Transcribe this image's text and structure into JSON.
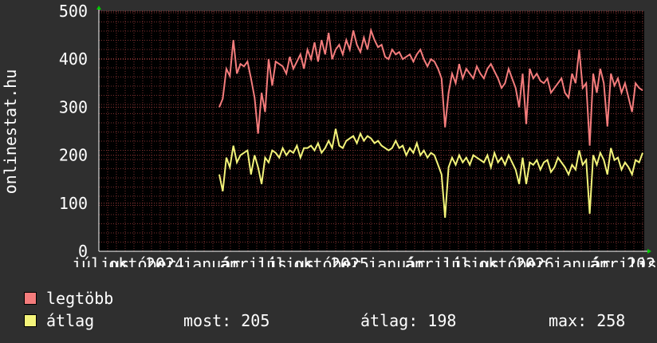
{
  "chart_data": {
    "type": "line",
    "ylabel": "onlinestat.hu",
    "ylim": [
      0,
      500
    ],
    "yticks": [
      0,
      100,
      200,
      300,
      400,
      500
    ],
    "xtick_labels": [
      "július",
      "október",
      "2024",
      "január",
      "április",
      "július",
      "október",
      "2025",
      "január",
      "április",
      "július",
      "október",
      "2026",
      "január",
      "április",
      "202"
    ],
    "grid": true,
    "colors": {
      "legtobb": "#f47c7c",
      "atlag": "#f4f47a",
      "grid": "#7a2f2f",
      "axis": "#ffffff",
      "plot_bg": "#000000"
    },
    "series": [
      {
        "name": "legtöbb",
        "values": [
          300,
          318,
          380,
          365,
          440,
          370,
          390,
          385,
          395,
          360,
          320,
          245,
          330,
          290,
          400,
          345,
          395,
          390,
          385,
          370,
          405,
          380,
          395,
          410,
          380,
          420,
          400,
          435,
          395,
          440,
          410,
          455,
          400,
          420,
          430,
          410,
          440,
          420,
          460,
          430,
          415,
          445,
          420,
          460,
          440,
          425,
          430,
          405,
          400,
          420,
          410,
          415,
          400,
          405,
          410,
          395,
          410,
          420,
          400,
          385,
          400,
          395,
          380,
          360,
          258,
          330,
          370,
          350,
          390,
          360,
          380,
          370,
          360,
          385,
          370,
          360,
          380,
          390,
          375,
          360,
          340,
          350,
          380,
          360,
          340,
          300,
          370,
          265,
          380,
          360,
          370,
          355,
          350,
          360,
          330,
          340,
          350,
          360,
          330,
          320,
          370,
          350,
          420,
          340,
          350,
          220,
          370,
          330,
          380,
          350,
          260,
          370,
          345,
          360,
          330,
          350,
          320,
          290,
          350,
          340,
          335
        ]
      },
      {
        "name": "átlag",
        "values": [
          160,
          125,
          195,
          175,
          220,
          185,
          200,
          205,
          210,
          160,
          200,
          175,
          140,
          195,
          185,
          210,
          205,
          195,
          215,
          200,
          210,
          205,
          220,
          195,
          215,
          215,
          220,
          210,
          225,
          205,
          215,
          230,
          215,
          255,
          220,
          215,
          230,
          235,
          240,
          225,
          245,
          230,
          240,
          235,
          225,
          230,
          220,
          215,
          210,
          215,
          230,
          215,
          220,
          200,
          215,
          205,
          225,
          200,
          210,
          195,
          205,
          200,
          180,
          160,
          70,
          175,
          195,
          180,
          200,
          185,
          195,
          180,
          200,
          195,
          190,
          185,
          200,
          175,
          205,
          185,
          195,
          180,
          200,
          185,
          170,
          140,
          195,
          140,
          185,
          180,
          190,
          170,
          185,
          190,
          165,
          175,
          195,
          185,
          175,
          160,
          180,
          170,
          210,
          180,
          190,
          78,
          200,
          180,
          205,
          190,
          160,
          215,
          190,
          195,
          170,
          185,
          175,
          160,
          190,
          185,
          205
        ]
      }
    ]
  },
  "legend": {
    "items": [
      {
        "label": "legtöbb",
        "color": "#f47c7c"
      },
      {
        "label": "átlag",
        "color": "#f4f47a"
      }
    ]
  },
  "stats": {
    "most": "most: 205",
    "atlag": "átlag: 198",
    "max": "max: 258"
  }
}
